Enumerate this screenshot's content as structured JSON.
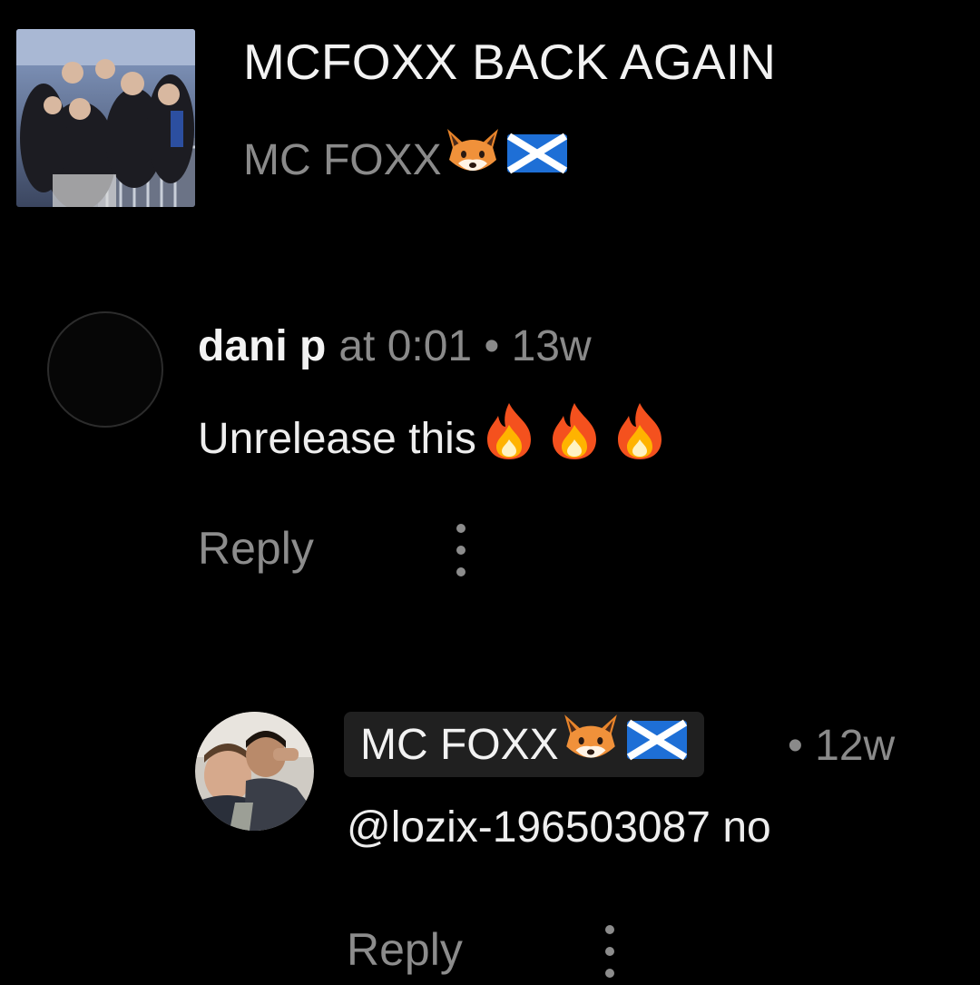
{
  "track": {
    "title": "MCFOXX BACK AGAIN",
    "artist": "MC FOXX"
  },
  "comments": [
    {
      "author": "dani p",
      "meta": "at 0:01 • 13w",
      "text": "Unrelease this",
      "reply_label": "Reply"
    },
    {
      "author": "MC FOXX",
      "time": "• 12w",
      "text": "@lozix-196503087 no",
      "reply_label": "Reply"
    }
  ],
  "icons": {
    "fox": "fox-emoji",
    "flag": "scotland-flag-emoji",
    "fire": "fire-emoji",
    "more": "vertical-ellipsis"
  },
  "colors": {
    "background": "#000000",
    "primary_text": "#f2f2f2",
    "secondary_text": "#8a8a8a",
    "chip_background": "#202020"
  }
}
